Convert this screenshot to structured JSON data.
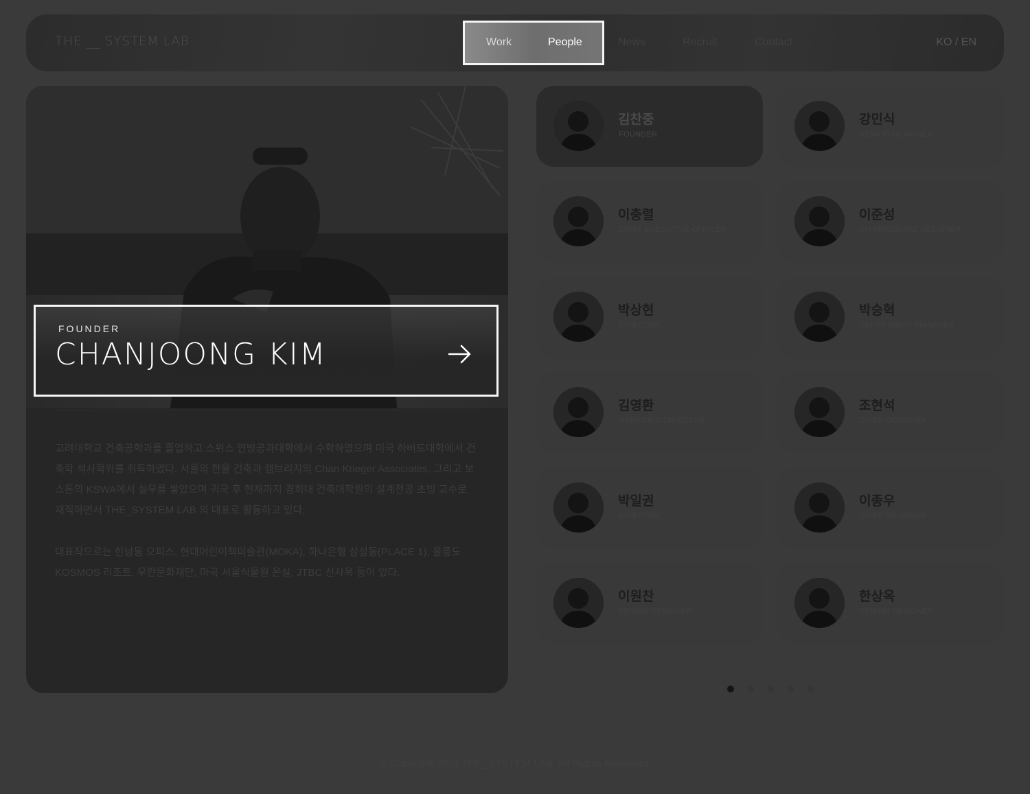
{
  "header": {
    "logo": "THE __ SYSTEM LAB",
    "nav": {
      "work": "Work",
      "people": "People",
      "news": "News",
      "recruit": "Recruit",
      "contact": "Contact"
    },
    "lang": "KO / EN"
  },
  "featured": {
    "role": "FOUNDER",
    "name": "CHANJOONG KIM",
    "bio": [
      "고려대학교 건축공학과를 졸업하고 스위스 연방공과대학에서 수학하였으며 미국 하버드대학에서 건축학 석사학위를 취득하였다. 서울의 한울 건축과 캠브리지의 Chan Krieger Associates, 그리고 보스톤의 KSWA에서 실무를 쌓았으며 귀국 후 현재까지 경희대 건축대학원의 설계전공 초빙 교수로 재직하면서 THE_SYSTEM LAB 의 대표로 활동하고 있다.",
      "대표작으로는 한남동 오피스, 현대어린이책미술관(MOKA), 하나은행 삼성동(PLACE 1), 울릉도 KOSMOS 리조트, 우란문화재단, 마곡 서울식물원 온실, JTBC 신사옥 등이 있다."
    ]
  },
  "people": [
    {
      "name": "김찬중",
      "role": "FOUNDER"
    },
    {
      "name": "강민식",
      "role": "SENIOR DESIGNER"
    },
    {
      "name": "이충렬",
      "role": "CHIEF EXECUTIVE OFFICER"
    },
    {
      "name": "이준성",
      "role": "INTERMEDIATE DESIGNER"
    },
    {
      "name": "박상현",
      "role": "DIRECTOR"
    },
    {
      "name": "박승혁",
      "role": "DEPARTMENT MANAGER"
    },
    {
      "name": "김영환",
      "role": "MANAGING DIRECTOR"
    },
    {
      "name": "조현석",
      "role": "CHIEF DESIGNER"
    },
    {
      "name": "박일권",
      "role": "DIRECTOR"
    },
    {
      "name": "이종우",
      "role": "CHIEF DESIGNER"
    },
    {
      "name": "이원찬",
      "role": "SENIOR DESIGNER"
    },
    {
      "name": "한상옥",
      "role": "SENIOR DESIGNER"
    }
  ],
  "pagination": {
    "pages": 5,
    "current": 1
  },
  "footer": "© Copyright 2024 THE_SYSTEM LAB. All Rights Reserved."
}
